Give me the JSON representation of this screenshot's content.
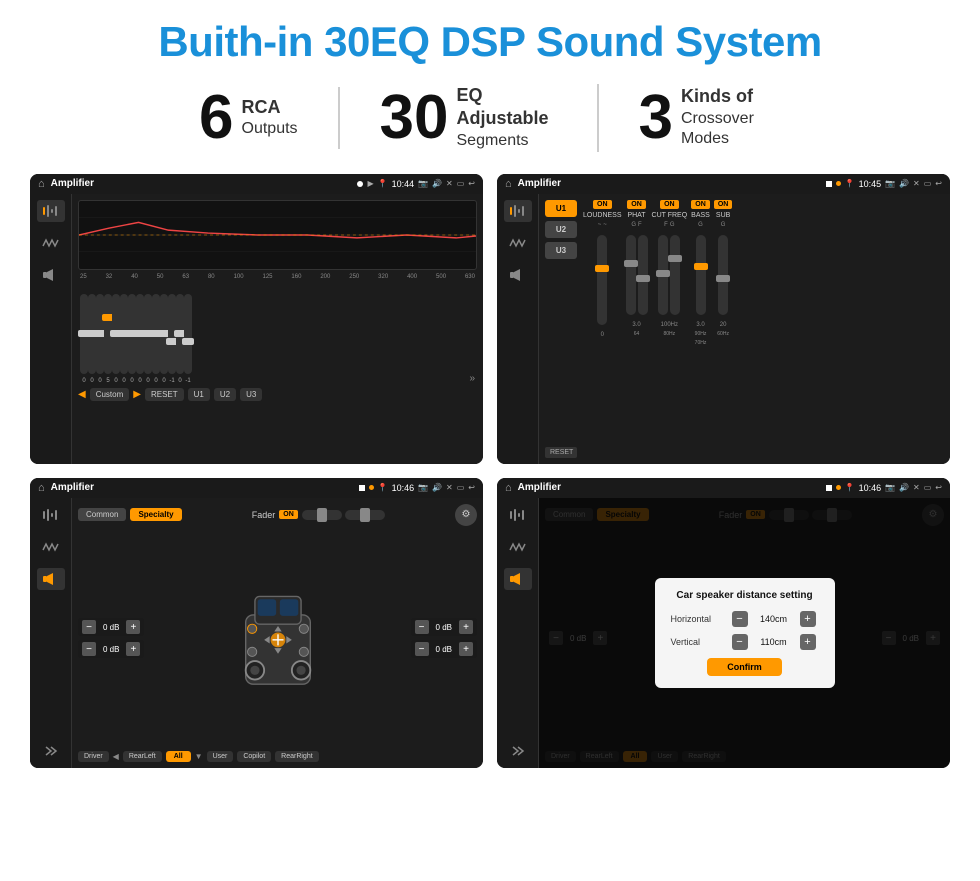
{
  "title": "Buith-in 30EQ DSP Sound System",
  "stats": [
    {
      "number": "6",
      "label_strong": "RCA",
      "label_text": "Outputs"
    },
    {
      "number": "30",
      "label_strong": "EQ Adjustable",
      "label_text": "Segments"
    },
    {
      "number": "3",
      "label_strong": "Kinds of",
      "label_text": "Crossover Modes"
    }
  ],
  "screens": [
    {
      "id": "screen-eq",
      "status_bar": {
        "title": "Amplifier",
        "time": "10:44"
      },
      "eq_bands": [
        "25",
        "32",
        "40",
        "50",
        "63",
        "80",
        "100",
        "125",
        "160",
        "200",
        "250",
        "320",
        "400",
        "500",
        "630"
      ],
      "eq_values": [
        "0",
        "0",
        "0",
        "5",
        "0",
        "0",
        "0",
        "0",
        "0",
        "0",
        "0",
        "-1",
        "0",
        "-1"
      ],
      "eq_preset": "Custom",
      "buttons": [
        "RESET",
        "U1",
        "U2",
        "U3"
      ]
    },
    {
      "id": "screen-crossover",
      "status_bar": {
        "title": "Amplifier",
        "time": "10:45"
      },
      "presets": [
        "U1",
        "U2",
        "U3"
      ],
      "channels": [
        "LOUDNESS",
        "PHAT",
        "CUT FREQ",
        "BASS",
        "SUB"
      ],
      "reset_label": "RESET"
    },
    {
      "id": "screen-fader",
      "status_bar": {
        "title": "Amplifier",
        "time": "10:46"
      },
      "tabs": [
        "Common",
        "Specialty"
      ],
      "fader_label": "Fader",
      "on_label": "ON",
      "db_values": [
        "0 dB",
        "0 dB",
        "0 dB",
        "0 dB"
      ],
      "bottom_buttons": [
        "Driver",
        "Copilot",
        "RearLeft",
        "All",
        "User",
        "RearRight"
      ]
    },
    {
      "id": "screen-distance",
      "status_bar": {
        "title": "Amplifier",
        "time": "10:46"
      },
      "tabs": [
        "Common",
        "Specialty"
      ],
      "fader_label": "Fader",
      "on_label": "ON",
      "dialog": {
        "title": "Car speaker distance setting",
        "horizontal_label": "Horizontal",
        "horizontal_value": "140cm",
        "vertical_label": "Vertical",
        "vertical_value": "110cm",
        "confirm_label": "Confirm"
      },
      "db_values": [
        "0 dB",
        "0 dB"
      ],
      "bottom_buttons": [
        "Driver",
        "Copilot",
        "RearLeft",
        "All",
        "User",
        "RearRight"
      ]
    }
  ]
}
